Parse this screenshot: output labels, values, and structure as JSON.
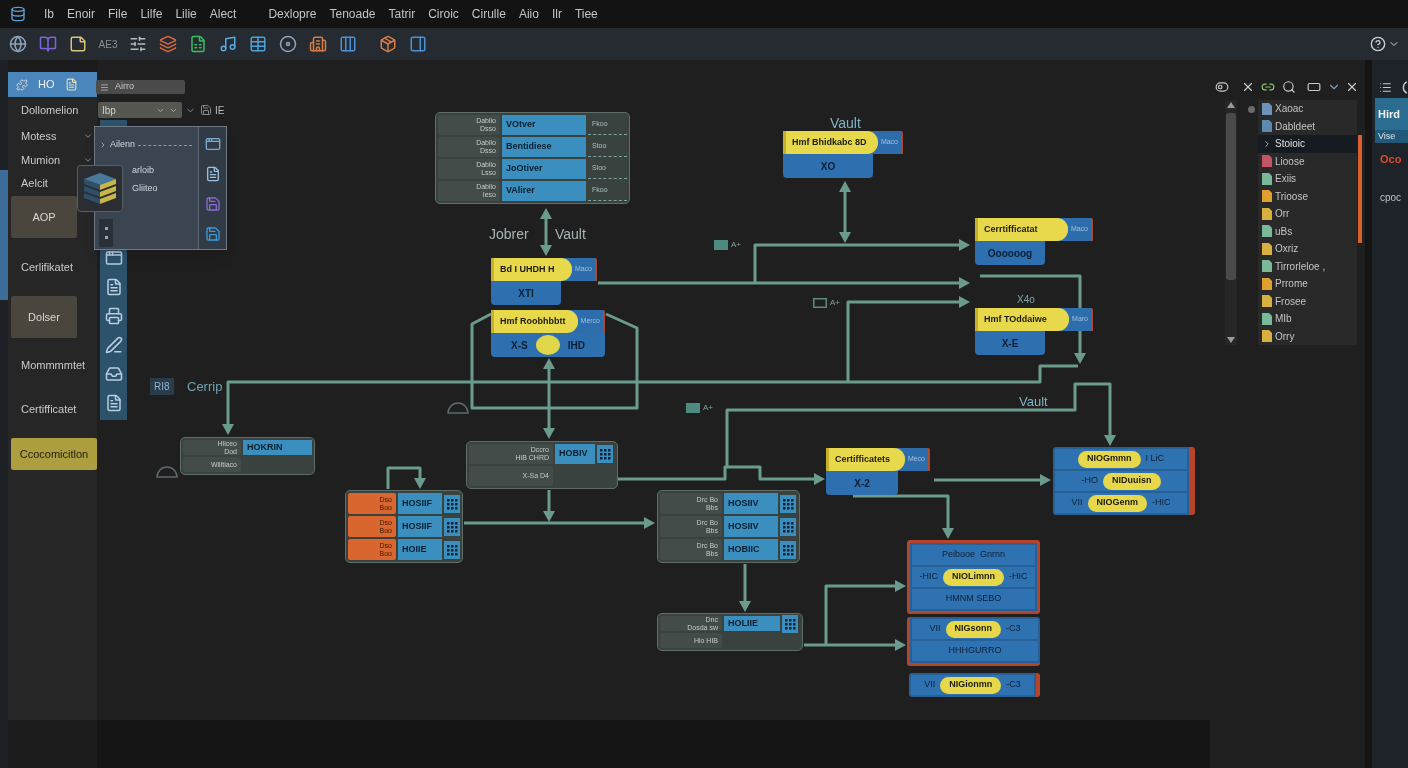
{
  "menu_bar": {
    "groups": [
      [
        "Ib",
        "Enoir",
        "File",
        "Lilfe",
        "Lilie",
        "Alect"
      ],
      [
        "Dexlopre",
        "Tenoade",
        "Tatrir",
        "Ciroic",
        "Cirulle",
        "Aiio",
        "Ilr",
        "Tiee"
      ]
    ]
  },
  "toolbar": {
    "text_button": "AE3"
  },
  "left_panel": {
    "header": "HO",
    "items": [
      {
        "kind": "label",
        "label": "Dollomelion"
      },
      {
        "kind": "dropdown",
        "label": "Motess"
      },
      {
        "kind": "dropdown",
        "label": "Mumion"
      },
      {
        "kind": "label",
        "label": "Aelcit"
      },
      {
        "kind": "button",
        "label": "AOP"
      },
      {
        "kind": "label",
        "label": "Cerlifikatet"
      },
      {
        "kind": "button",
        "label": "Dolser"
      },
      {
        "kind": "label",
        "label": "Mommmmtet"
      },
      {
        "kind": "label",
        "label": "Certifficatet"
      },
      {
        "kind": "accent_button",
        "label": "Ccocomicitlon"
      }
    ]
  },
  "workspace": {
    "layer_dropdown": {
      "value": "Airro"
    },
    "type_dropdown": {
      "value": "Ibp"
    },
    "view_label": "IE"
  },
  "popup_menu": {
    "items": [
      {
        "label": "Ailenn",
        "submenu": true
      },
      {
        "label": "arloib",
        "submenu": false
      },
      {
        "label": "Gliiteo",
        "submenu": false
      }
    ]
  },
  "diagram": {
    "labels": [
      {
        "kind": "text",
        "text": "Vault"
      },
      {
        "kind": "text",
        "text": "Jobrer"
      },
      {
        "kind": "text",
        "text": "Vault"
      },
      {
        "kind": "marker",
        "text": "A+"
      },
      {
        "kind": "marker",
        "text": "A+"
      },
      {
        "kind": "text",
        "text": "X4o"
      },
      {
        "kind": "tag",
        "text": "RI8"
      },
      {
        "kind": "text",
        "text": "Cerrip"
      },
      {
        "kind": "text",
        "text": "Vault"
      },
      {
        "kind": "marker",
        "text": "A+"
      }
    ],
    "nodes": [
      {
        "kind": "table",
        "rows": [
          {
            "label": "Dablio",
            "sublabel": "Dsso",
            "value": "VOtver",
            "note": "Fkoo"
          },
          {
            "label": "Dablio",
            "sublabel": "Dsso",
            "value": "Bentidiese",
            "note": "Stoo"
          },
          {
            "label": "Dablio",
            "sublabel": "Lsso",
            "value": "JoOtiver",
            "note": "Sloo"
          },
          {
            "label": "Dablio",
            "sublabel": "Ieso",
            "value": "VAlirer",
            "note": "Fkoo"
          }
        ]
      },
      {
        "kind": "pill",
        "title": "Hmf Bhidkabc 8D",
        "tag": "Maco",
        "footer": [
          {
            "kind": "text",
            "text": "XO"
          }
        ]
      },
      {
        "kind": "pill",
        "title": "Bd I UHDH H",
        "tag": "Maco",
        "footer": [
          {
            "kind": "text",
            "text": "XTI"
          }
        ]
      },
      {
        "kind": "pill",
        "title": "Cerrtifficatat",
        "tag": "Maco",
        "footer": [
          {
            "kind": "text",
            "text": "Oooooog"
          }
        ]
      },
      {
        "kind": "pill",
        "title": "Hmf Roobhbbtt",
        "tag": "Merco",
        "footer": [
          {
            "kind": "text",
            "text": "X-S"
          },
          {
            "kind": "knob"
          },
          {
            "kind": "text",
            "text": "IHD"
          }
        ]
      },
      {
        "kind": "pill",
        "title": "Hmf TOddaiwe",
        "tag": "Maro",
        "footer": [
          {
            "kind": "text",
            "text": "X-E"
          }
        ]
      },
      {
        "kind": "grid",
        "rows": [
          {
            "label": "Hliceo",
            "sublabel": "Dod",
            "value": "HOKRIN"
          },
          {
            "label": "Willtiaco"
          }
        ]
      },
      {
        "kind": "grid",
        "rows": [
          {
            "label": "Dccro",
            "sublabel": "HiB CHRD",
            "value": "HOBIV",
            "pattern": true
          },
          {
            "label": "X-Sa D4"
          }
        ]
      },
      {
        "kind": "pill",
        "title": "Certifficatets",
        "tag": "Meco",
        "footer": [
          {
            "kind": "text",
            "text": "X-2"
          }
        ]
      },
      {
        "kind": "stack",
        "lines": [
          {
            "parts": [
              {
                "kind": "pill",
                "text": "NIOGmmn"
              },
              {
                "kind": "text",
                "text": "I LiC"
              }
            ]
          },
          {
            "parts": [
              {
                "kind": "text",
                "text": "-HO"
              },
              {
                "kind": "pill",
                "text": "NIDuuisn"
              }
            ]
          },
          {
            "parts": [
              {
                "kind": "text",
                "text": "VII"
              },
              {
                "kind": "pill",
                "text": "NIOGenm"
              },
              {
                "kind": "text",
                "text": "-HIC"
              }
            ]
          }
        ]
      },
      {
        "kind": "grid",
        "color": "#d9652f",
        "rows": [
          {
            "label": "Dso",
            "sublabel": "Boo",
            "value": "HOSIIF",
            "pattern": true
          },
          {
            "label": "Dso",
            "sublabel": "Boo",
            "value": "HOSIIF",
            "pattern": true
          },
          {
            "label": "Dso",
            "sublabel": "Boo",
            "value": "HOIIE",
            "pattern": true
          }
        ]
      },
      {
        "kind": "grid",
        "rows": [
          {
            "label": "Drc Bo",
            "sublabel": "Bbs",
            "value": "HOSIIV",
            "pattern": true
          },
          {
            "label": "Drc Bo",
            "sublabel": "Bbs",
            "value": "HOSIIV",
            "pattern": true
          },
          {
            "label": "Drc Bo",
            "sublabel": "Bbs",
            "value": "HOBIIC",
            "pattern": true
          }
        ]
      },
      {
        "kind": "stack",
        "lines": [
          {
            "parts": [
              {
                "kind": "text",
                "text": "Peibooe"
              },
              {
                "kind": "text",
                "text": "Gnrnn"
              }
            ]
          },
          {
            "parts": [
              {
                "kind": "text",
                "text": "-HIC"
              },
              {
                "kind": "pill",
                "text": "NIOLimnn"
              },
              {
                "kind": "text",
                "text": "-HIC"
              }
            ]
          },
          {
            "parts": [
              {
                "kind": "text",
                "text": "HMNM SEBO"
              }
            ]
          }
        ]
      },
      {
        "kind": "grid",
        "rows": [
          {
            "label": "Dnc",
            "sublabel": "Dosda sw",
            "value": "HOLIIE",
            "pattern": true
          },
          {
            "label": "Hio HIB"
          }
        ]
      },
      {
        "kind": "stack",
        "lines": [
          {
            "parts": [
              {
                "kind": "text",
                "text": "VII"
              },
              {
                "kind": "pill",
                "text": "NIGsonn"
              },
              {
                "kind": "text",
                "text": "-C3"
              }
            ]
          },
          {
            "parts": [
              {
                "kind": "text",
                "text": "HHHGURRO"
              }
            ]
          }
        ]
      },
      {
        "kind": "stack",
        "lines": [
          {
            "parts": [
              {
                "kind": "text",
                "text": "VII"
              },
              {
                "kind": "pill",
                "text": "NIGionmn"
              },
              {
                "kind": "text",
                "text": "-C3"
              }
            ]
          }
        ]
      }
    ]
  },
  "outline_panel": {
    "items": [
      {
        "label": "Xaoac",
        "color": "#6d93bb",
        "selected": false
      },
      {
        "label": "Dabldeet",
        "color": "#5b8ab0",
        "selected": false
      },
      {
        "label": "Stoioic",
        "selected": true
      },
      {
        "label": "Lioose",
        "color": "#c25463",
        "selected": false
      },
      {
        "label": "Exiis",
        "color": "#7ab89a",
        "selected": false
      },
      {
        "label": "Trioose",
        "color": "#e0a030",
        "selected": false
      },
      {
        "label": "Orr",
        "color": "#d8b040",
        "selected": false
      },
      {
        "label": "uBs",
        "color": "#7ab89a",
        "selected": false
      },
      {
        "label": "Oxriz",
        "color": "#d8b040",
        "selected": false
      },
      {
        "label": "Tirrorleloe ,",
        "color": "#7ab89a",
        "selected": false
      },
      {
        "label": "Prrome",
        "color": "#e0a030",
        "selected": false
      },
      {
        "label": "Frosee",
        "color": "#d8b040",
        "selected": false
      },
      {
        "label": "MIb",
        "color": "#7ab89a",
        "selected": false
      },
      {
        "label": "Orry",
        "color": "#d8b040",
        "selected": false
      }
    ]
  },
  "side_panel": {
    "title": "Hird",
    "subtitle": "Vise",
    "alert": "Oco",
    "text": "cpoc"
  }
}
